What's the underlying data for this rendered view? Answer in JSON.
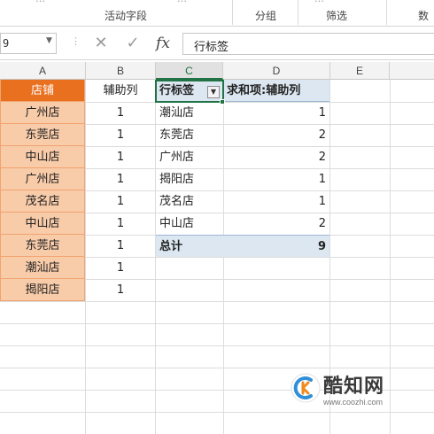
{
  "ribbon": {
    "groups": [
      "活动字段",
      "分组",
      "筛选",
      "数"
    ],
    "fragments": [
      "…",
      "…",
      "…"
    ]
  },
  "formula_bar": {
    "name_box": "9",
    "cancel_symbol": "✕",
    "confirm_symbol": "✓",
    "fx_label": "fx",
    "content": "行标签"
  },
  "columns": [
    "A",
    "B",
    "C",
    "D",
    "E"
  ],
  "selected_column": "C",
  "source_table": {
    "headers": [
      "店铺",
      "辅助列"
    ],
    "rows": [
      {
        "store": "广州店",
        "helper": "1"
      },
      {
        "store": "东莞店",
        "helper": "1"
      },
      {
        "store": "中山店",
        "helper": "1"
      },
      {
        "store": "广州店",
        "helper": "1"
      },
      {
        "store": "茂名店",
        "helper": "1"
      },
      {
        "store": "中山店",
        "helper": "1"
      },
      {
        "store": "东莞店",
        "helper": "1"
      },
      {
        "store": "潮汕店",
        "helper": "1"
      },
      {
        "store": "揭阳店",
        "helper": "1"
      }
    ]
  },
  "pivot_table": {
    "row_label_header": "行标签",
    "value_header": "求和项:辅助列",
    "rows": [
      {
        "label": "潮汕店",
        "value": "1"
      },
      {
        "label": "东莞店",
        "value": "2"
      },
      {
        "label": "广州店",
        "value": "2"
      },
      {
        "label": "揭阳店",
        "value": "1"
      },
      {
        "label": "茂名店",
        "value": "1"
      },
      {
        "label": "中山店",
        "value": "2"
      }
    ],
    "total_label": "总计",
    "total_value": "9"
  },
  "watermark": {
    "brand": "酷知网",
    "url": "www.coozhi.com"
  },
  "colors": {
    "header_orange": "#e8701f",
    "cell_peach": "#f8cba9",
    "pivot_blue": "#dde7f1",
    "excel_green": "#217346"
  }
}
